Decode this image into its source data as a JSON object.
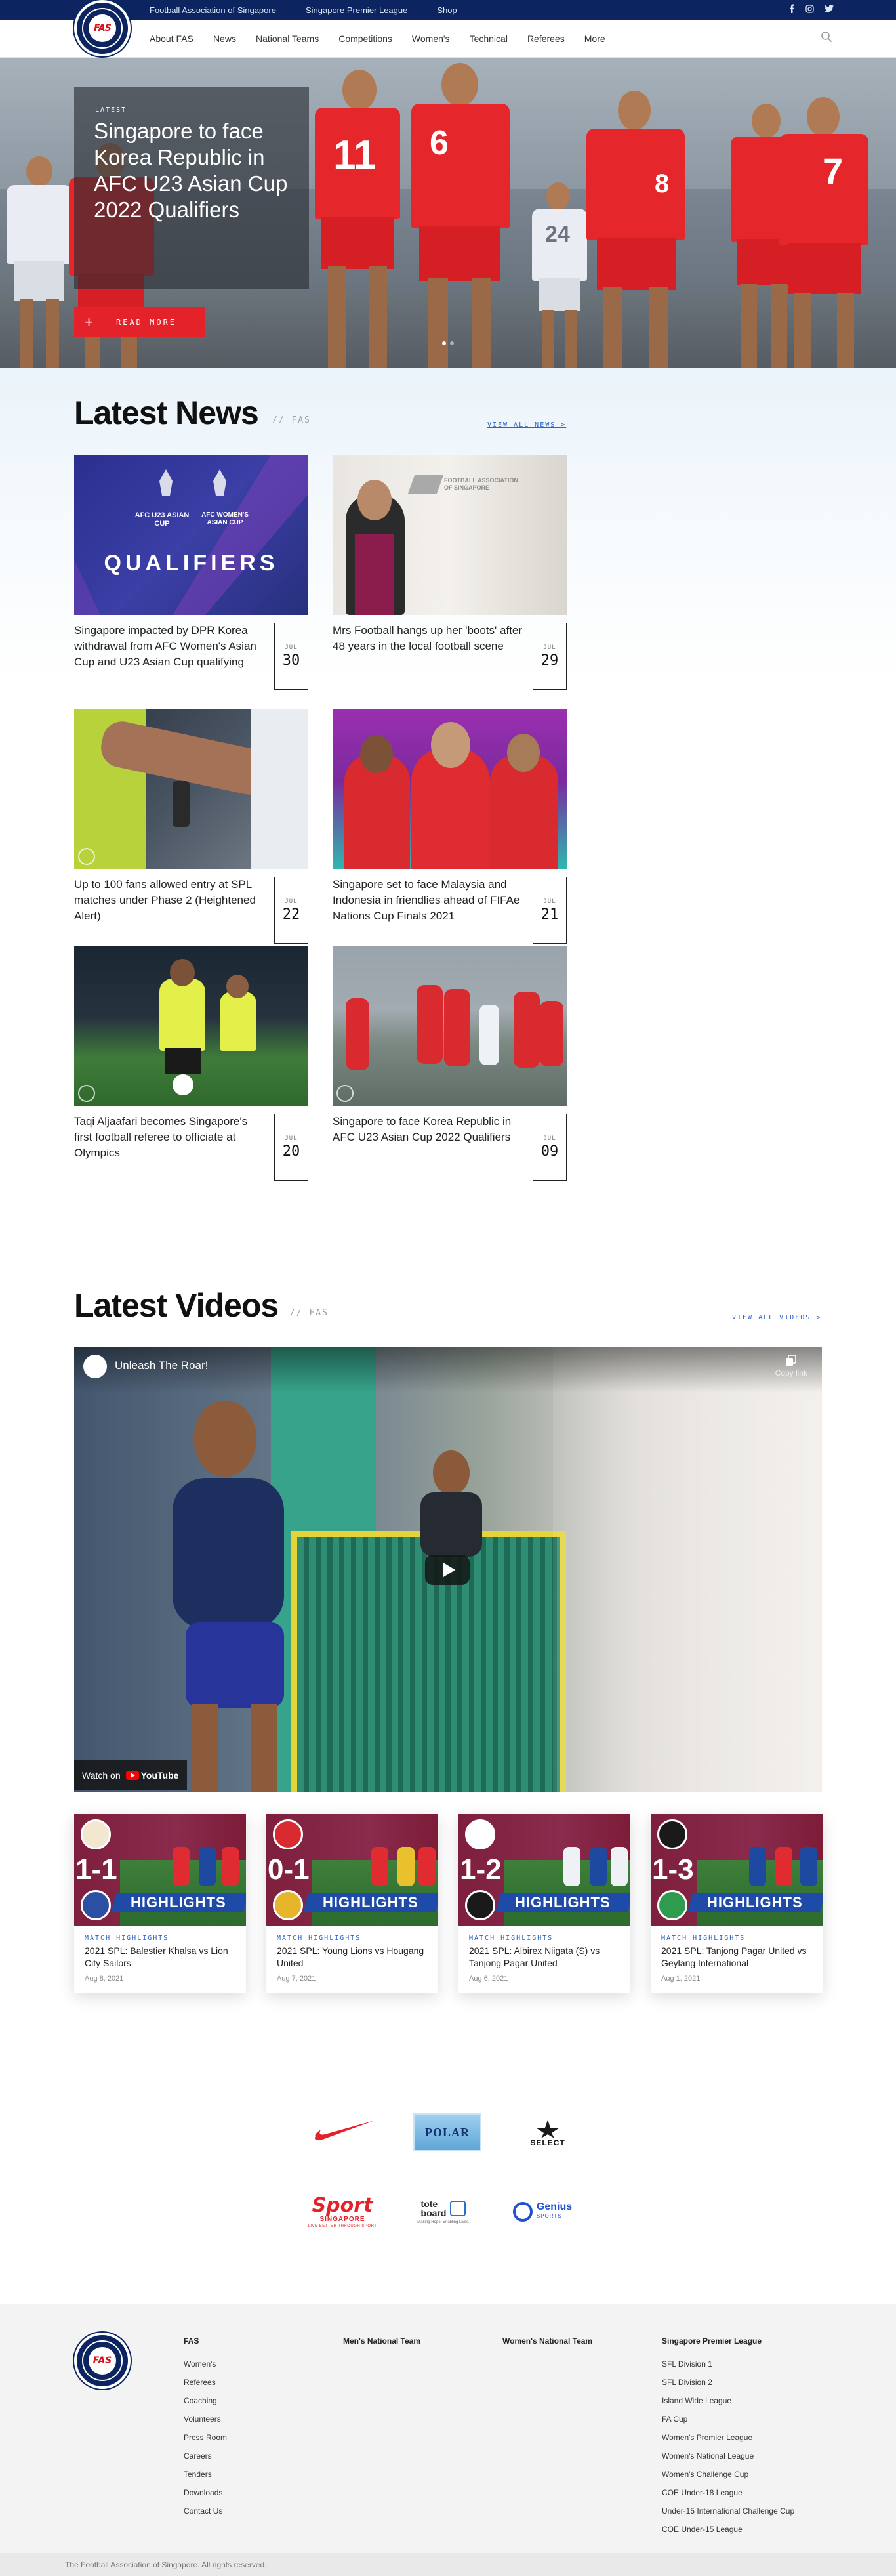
{
  "topbar": {
    "links": [
      "Football Association of Singapore",
      "Singapore Premier League",
      "Shop"
    ],
    "social_icons": [
      "facebook-icon",
      "instagram-icon",
      "twitter-icon"
    ]
  },
  "nav": {
    "logo_alt": "FAS",
    "items": [
      "About FAS",
      "News",
      "National Teams",
      "Competitions",
      "Women's",
      "Technical",
      "Referees",
      "More"
    ]
  },
  "hero": {
    "tag": "LATEST",
    "title": "Singapore to face Korea Republic in AFC U23 Asian Cup 2022 Qualifiers",
    "button": "READ MORE",
    "slides": 2,
    "active_slide": 1
  },
  "news": {
    "title": "Latest News",
    "subtitle": "// FAS",
    "view_all": "VIEW ALL NEWS >",
    "items": [
      {
        "title": "Singapore impacted by DPR Korea withdrawal from AFC Women's Asian Cup and U23 Asian Cup qualifying",
        "month": "JUL",
        "day": "30"
      },
      {
        "title": "Mrs Football hangs up her 'boots' after 48 years in the local football scene",
        "month": "JUL",
        "day": "29"
      },
      {
        "title": "Up to 100 fans allowed entry at SPL matches under Phase 2 (Heightened Alert)",
        "month": "JUL",
        "day": "22"
      },
      {
        "title": "Singapore set to face Malaysia and Indonesia in friendlies ahead of FIFAe Nations Cup Finals 2021",
        "month": "JUL",
        "day": "21"
      },
      {
        "title": "Taqi Aljaafari becomes Singapore's first football referee to officiate at Olympics",
        "month": "JUL",
        "day": "20"
      },
      {
        "title": "Singapore to face Korea Republic in AFC U23 Asian Cup 2022 Qualifiers",
        "month": "JUL",
        "day": "09"
      }
    ],
    "thumb_text": {
      "qualifiers": "QUALIFIERS",
      "u23": "AFC U23 ASIAN CUP",
      "womens": "AFC WOMEN'S ASIAN CUP",
      "fas_wall": "FOOTBALL ASSOCIATION OF SINGAPORE"
    }
  },
  "videos": {
    "title": "Latest Videos",
    "subtitle": "// FAS",
    "view_all": "VIEW ALL VIDEOS >",
    "player": {
      "title": "Unleash The Roar!",
      "copy_link": "Copy link",
      "watch_on": "Watch on",
      "youtube": "YouTube"
    },
    "items": [
      {
        "score": "1-1",
        "category": "MATCH HIGHLIGHTS",
        "title": "2021 SPL: Balestier Khalsa vs Lion City Sailors",
        "date": "Aug 8, 2021"
      },
      {
        "score": "0-1",
        "category": "MATCH HIGHLIGHTS",
        "title": "2021 SPL: Young Lions vs Hougang United",
        "date": "Aug 7, 2021"
      },
      {
        "score": "1-2",
        "category": "MATCH HIGHLIGHTS",
        "title": "2021 SPL: Albirex Niigata (S) vs Tanjong Pagar United",
        "date": "Aug 6, 2021"
      },
      {
        "score": "1-3",
        "category": "MATCH HIGHLIGHTS",
        "title": "2021 SPL: Tanjong Pagar United vs Geylang International",
        "date": "Aug 1, 2021"
      }
    ],
    "highlight_label": "HIGHLIGHTS"
  },
  "sponsors": {
    "polar": "POLAR",
    "select": "SELECT",
    "sport": "Sport",
    "sport_sub": "SINGAPORE",
    "sport_tag": "LIVE BETTER THROUGH SPORT",
    "tote1": "tote",
    "tote2": "board",
    "tote_tag": "Making Hope. Enabling Lives.",
    "genius": "Genius",
    "genius_sub": "SPORTS"
  },
  "footer": {
    "columns": [
      {
        "heading": "FAS",
        "links": [
          "Women's",
          "Referees",
          "Coaching",
          "Volunteers",
          "Press Room",
          "Careers",
          "Tenders",
          "Downloads",
          "Contact Us"
        ]
      },
      {
        "heading": "Men's National Team",
        "links": []
      },
      {
        "heading": "Women's National Team",
        "links": []
      },
      {
        "heading": "Singapore Premier League",
        "links": [
          "SFL Division 1",
          "SFL Division 2",
          "Island Wide League",
          "FA Cup",
          "Women's Premier League",
          "Women's National League",
          "Women's Challenge Cup",
          "COE Under-18 League",
          "Under-15 International Challenge Cup",
          "COE Under-15 League"
        ]
      }
    ],
    "copyright": "The Football Association of Singapore. All rights reserved."
  },
  "colors": {
    "navy": "#0c2560",
    "accent_red": "#e4222a",
    "link_blue": "#2c63c6"
  }
}
